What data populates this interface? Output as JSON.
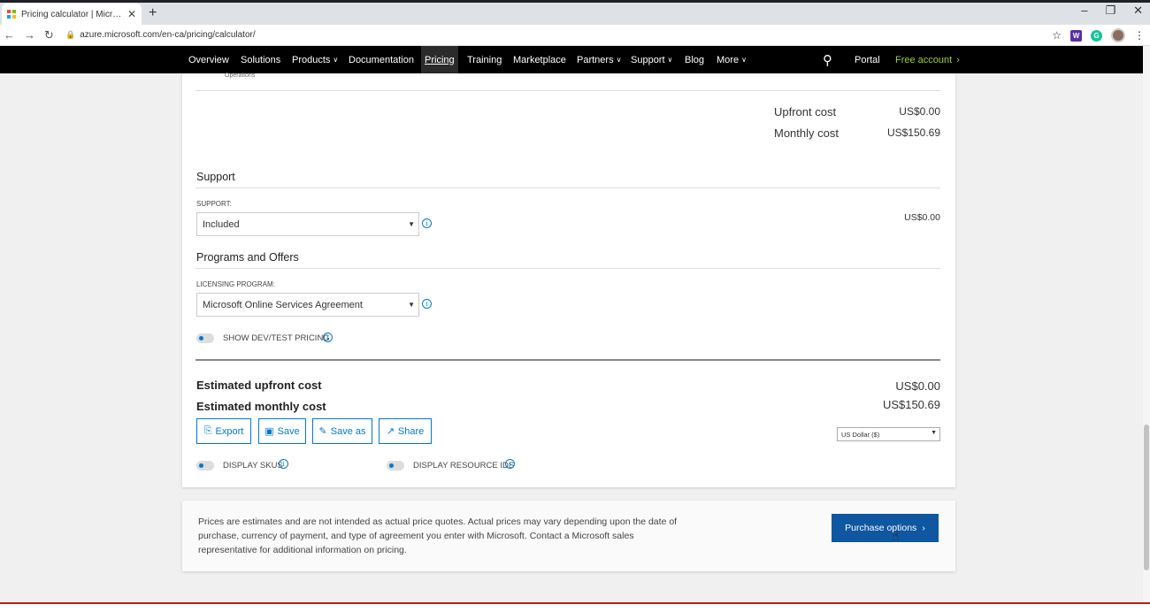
{
  "browser": {
    "tab_title": "Pricing calculator | Microsoft Azure",
    "url": "azure.microsoft.com/en-ca/pricing/calculator/"
  },
  "nav": {
    "items": [
      {
        "label": "Overview"
      },
      {
        "label": "Solutions"
      },
      {
        "label": "Products"
      },
      {
        "label": "Documentation"
      },
      {
        "label": "Pricing"
      },
      {
        "label": "Training"
      },
      {
        "label": "Marketplace"
      },
      {
        "label": "Partners"
      },
      {
        "label": "Support"
      },
      {
        "label": "Blog"
      },
      {
        "label": "More"
      }
    ],
    "portal": "Portal",
    "free_account": "Free account"
  },
  "top": {
    "cut_label": "Operations",
    "upfront_label": "Upfront cost",
    "upfront_value": "US$0.00",
    "monthly_label": "Monthly cost",
    "monthly_value": "US$150.69"
  },
  "support": {
    "title": "Support",
    "field_label": "SUPPORT:",
    "selected": "Included",
    "cost": "US$0.00"
  },
  "programs": {
    "title": "Programs and Offers",
    "field_label": "LICENSING PROGRAM:",
    "selected": "Microsoft Online Services Agreement",
    "devtest_label": "SHOW DEV/TEST PRICING"
  },
  "estimate": {
    "upfront_label": "Estimated upfront cost",
    "upfront_value": "US$0.00",
    "monthly_label": "Estimated monthly cost",
    "monthly_value": "US$150.69"
  },
  "actions": {
    "export": "Export",
    "save": "Save",
    "save_as": "Save as",
    "share": "Share"
  },
  "currency": "US Dollar ($)",
  "toggles": {
    "display_skus": "DISPLAY SKUS",
    "display_resource_ids": "DISPLAY RESOURCE IDS"
  },
  "footer": {
    "disclaimer": "Prices are estimates and are not intended as actual price quotes. Actual prices may vary depending upon the date of purchase, currency of payment, and type of agreement you enter with Microsoft. Contact a Microsoft sales representative for additional information on pricing.",
    "purchase_button": "Purchase options"
  },
  "colors": {
    "accent": "#0078d4",
    "purchase_bg": "#0f57a0",
    "nav_bg": "#000000",
    "free_account": "#9bd13c"
  }
}
